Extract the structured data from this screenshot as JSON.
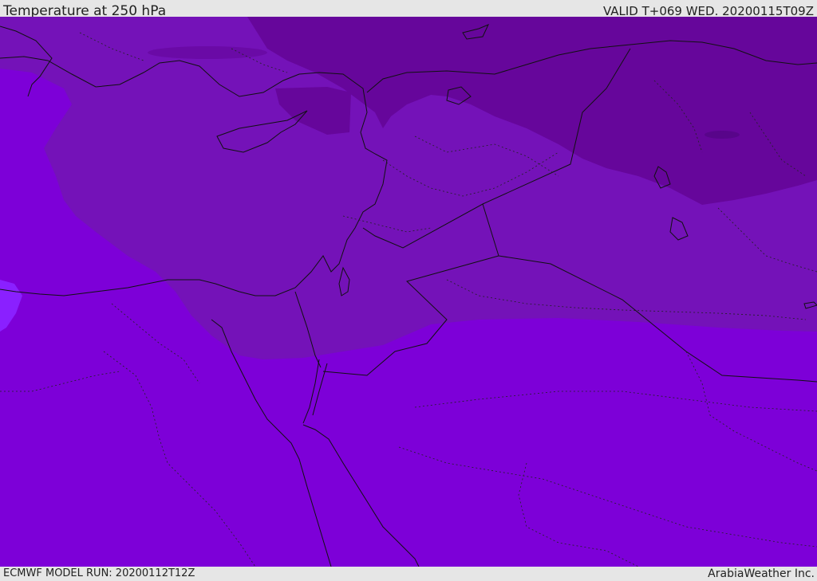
{
  "header": {
    "title": "Temperature at 250 hPa",
    "valid": "VALID T+069 WED. 20200115T09Z"
  },
  "footer": {
    "model_run": "ECMWF MODEL RUN: 20200112T12Z",
    "credit": "ArabiaWeather Inc."
  },
  "map": {
    "colors": {
      "base": "#7d00d8",
      "band_mid": "#7412b8",
      "band_dark": "#66069b",
      "border": "#111111"
    }
  }
}
